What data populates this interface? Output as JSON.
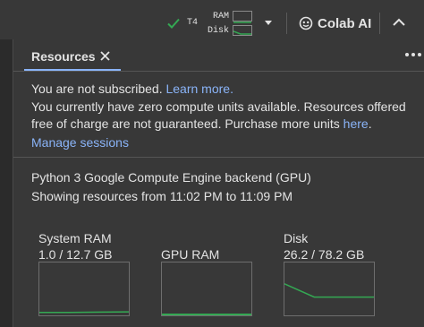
{
  "toolbar": {
    "gpu": "T4",
    "ram_label": "RAM",
    "disk_label": "Disk",
    "colab_ai": "Colab AI"
  },
  "tab": {
    "label": "Resources"
  },
  "messages": {
    "not_subscribed": "You are not subscribed.",
    "learn_more": "Learn more.",
    "units_line1": "You currently have zero compute units available. Resources offered",
    "units_line2_prefix": "free of charge are not guaranteed. Purchase more units ",
    "here": "here",
    "units_line2_suffix": ".",
    "manage_sessions": "Manage sessions"
  },
  "backend": {
    "name": "Python 3 Google Compute Engine backend (GPU)",
    "range": "Showing resources from 11:02 PM to 11:09 PM"
  },
  "graphs": [
    {
      "title": "System RAM",
      "value": "1.0 / 12.7 GB",
      "usage": [
        0.04,
        0.04,
        0.045,
        0.05
      ]
    },
    {
      "title": "GPU RAM",
      "value": "",
      "usage": [
        0.0,
        0.0,
        0.0,
        0.0
      ]
    },
    {
      "title": "Disk",
      "value": "26.2 / 78.2 GB",
      "usage": [
        0.6,
        0.34,
        0.34,
        0.34
      ]
    }
  ],
  "colors": {
    "accent": "#8ab4f8",
    "success": "#34a853",
    "background": "#383838"
  },
  "icons": [
    "check-icon",
    "dropdown-caret-icon",
    "colab-ai-icon",
    "chevron-up-icon",
    "close-icon",
    "more-menu-icon"
  ]
}
